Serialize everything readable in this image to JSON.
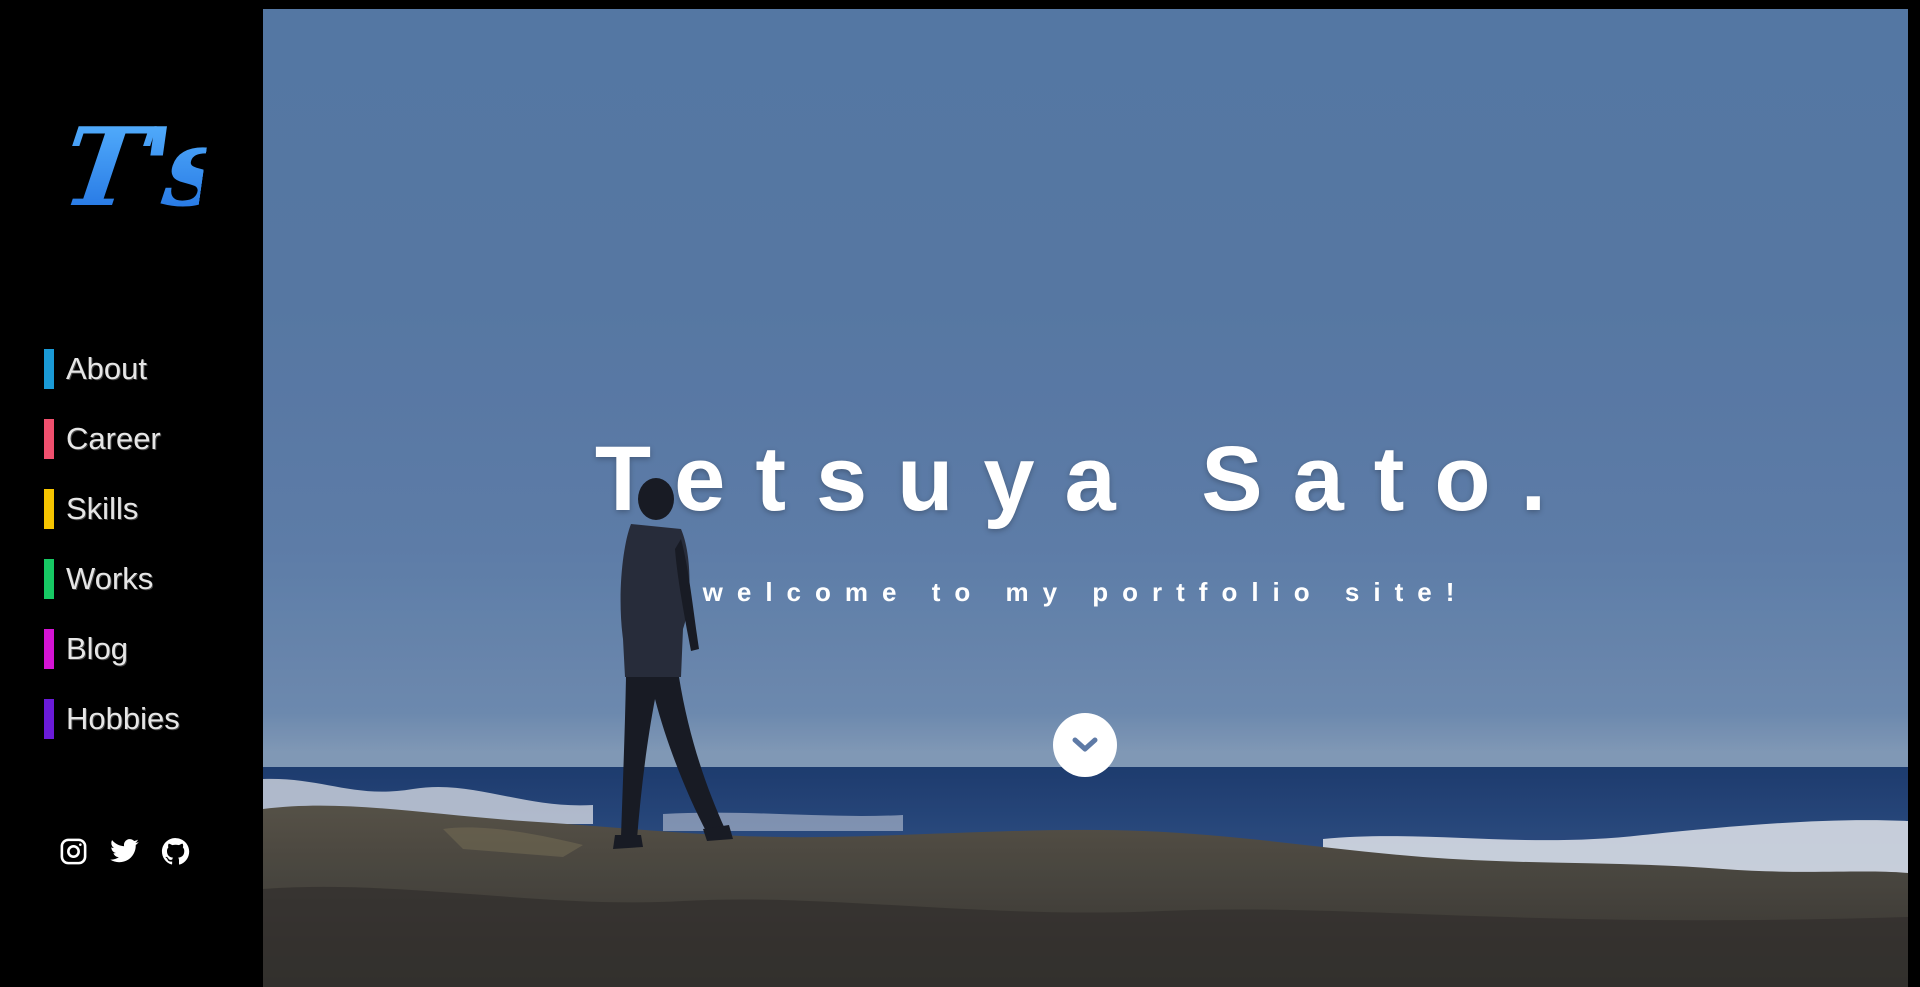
{
  "logo": {
    "text": "T's"
  },
  "nav": {
    "items": [
      {
        "label": "About",
        "color": "#1a9ad6"
      },
      {
        "label": "Career",
        "color": "#f0506e"
      },
      {
        "label": "Skills",
        "color": "#f5c400"
      },
      {
        "label": "Works",
        "color": "#17c964"
      },
      {
        "label": "Blog",
        "color": "#d414d4"
      },
      {
        "label": "Hobbies",
        "color": "#6a1bd8"
      }
    ]
  },
  "social": {
    "icons": [
      "instagram-icon",
      "twitter-icon",
      "github-icon"
    ]
  },
  "hero": {
    "title": "Tetsuya Sato.",
    "subtitle": "welcome to my portfolio site!",
    "scroll_icon": "chevron-down-icon"
  }
}
